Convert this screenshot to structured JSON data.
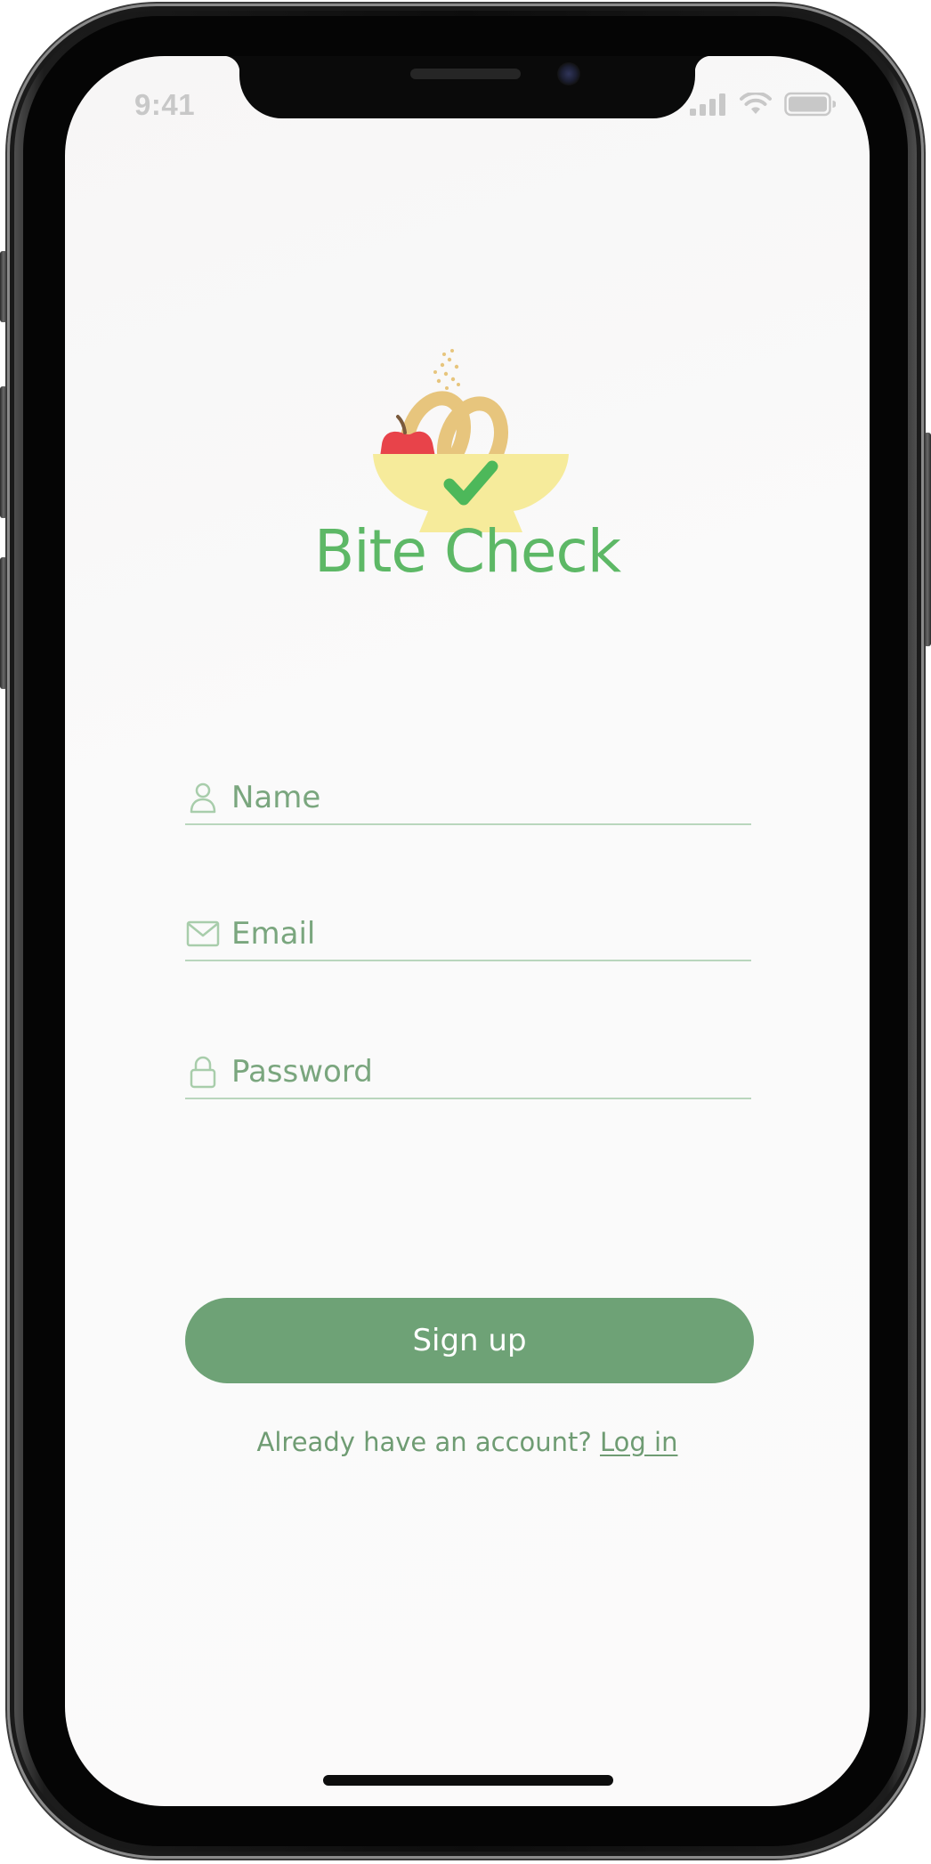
{
  "status_bar": {
    "time": "9:41",
    "icons": [
      "cellular-signal-icon",
      "wifi-icon",
      "battery-icon"
    ]
  },
  "brand": {
    "app_name": "Bite Check",
    "logo_icon": "food-bowl-checkmark-logo"
  },
  "form": {
    "name": {
      "placeholder": "Name",
      "value": "",
      "icon": "person-icon"
    },
    "email": {
      "placeholder": "Email",
      "value": "",
      "icon": "envelope-icon"
    },
    "password": {
      "placeholder": "Password",
      "value": "",
      "icon": "lock-icon"
    }
  },
  "actions": {
    "signup_label": "Sign up",
    "login_prompt": "Already have an account?",
    "login_link": "Log in"
  },
  "colors": {
    "accent_green": "#6ea276",
    "brand_green": "#5db866",
    "apple_red": "#e8434a",
    "pretzel_tan": "#e7c57d",
    "bowl_yellow": "#f6eb9b"
  }
}
